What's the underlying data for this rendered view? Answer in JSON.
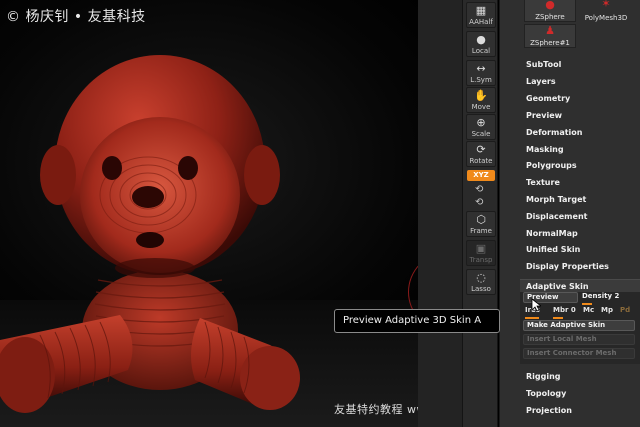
{
  "watermark": {
    "top": "© 杨庆钊 • 友基科技",
    "bottom": "友基特约教程 www.ugee.com.cn"
  },
  "colors": {
    "model_red": "#a82a1c",
    "accent_orange": "#f08a1b",
    "panel_bg": "#2f2f2f",
    "shelf_bg": "#2a2a2a"
  },
  "shelf": {
    "buttons": [
      {
        "label": "AAHalf",
        "icon": "aahalf-icon"
      },
      {
        "label": "Local",
        "icon": "local-sphere-icon"
      },
      {
        "label": "L.Sym",
        "icon": "lsym-icon"
      },
      {
        "label": "Move",
        "icon": "hand-move-icon"
      },
      {
        "label": "Scale",
        "icon": "scale-icon"
      },
      {
        "label": "Rotate",
        "icon": "rotate-icon"
      },
      {
        "label": "Frame",
        "icon": "frame-cube-icon"
      },
      {
        "label": "Transp",
        "icon": "transp-icon"
      },
      {
        "label": "Lasso",
        "icon": "lasso-icon"
      }
    ],
    "xyz_label": "XYZ"
  },
  "tools": {
    "items": [
      {
        "label": "ZSphere"
      },
      {
        "label": "PolyMesh3D"
      },
      {
        "label": "ZSphere#1"
      }
    ]
  },
  "menu": {
    "items": [
      "SubTool",
      "Layers",
      "Geometry",
      "Preview",
      "Deformation",
      "Masking",
      "Polygroups",
      "Texture",
      "Morph Target",
      "Displacement",
      "NormalMap",
      "Unified Skin",
      "Display Properties"
    ],
    "bottom_items": [
      "Rigging",
      "Topology",
      "Projection"
    ]
  },
  "adaptive_skin": {
    "title": "Adaptive Skin",
    "preview_label": "Preview",
    "density_label": "Density 2",
    "density_value": 2,
    "ires_label": "Ires",
    "mbr_label": "Mbr 0",
    "mc_label": "Mc",
    "mp_label": "Mp",
    "pd_label": "Pd",
    "make_label": "Make Adaptive Skin",
    "insert_local_label": "Insert Local Mesh",
    "insert_connector_label": "Insert Connector Mesh"
  },
  "tooltip": {
    "text": "Preview Adaptive 3D Skin  A"
  }
}
